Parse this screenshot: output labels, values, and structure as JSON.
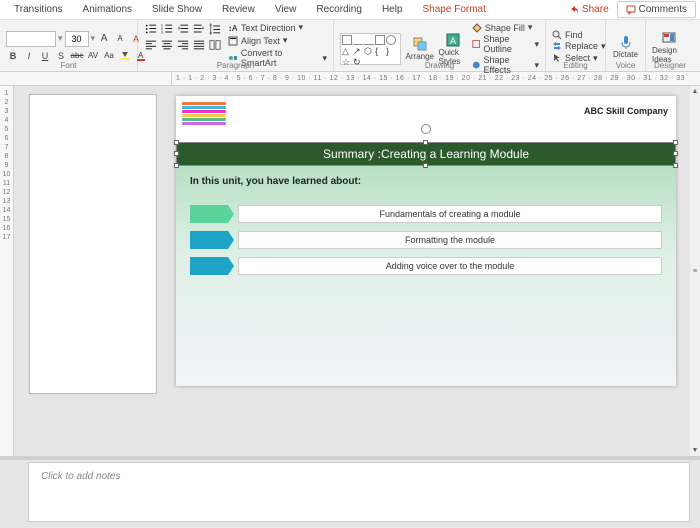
{
  "tabs": {
    "items": [
      "Transitions",
      "Animations",
      "Slide Show",
      "Review",
      "View",
      "Recording",
      "Help",
      "Shape Format"
    ],
    "active_index": 7
  },
  "topright": {
    "share": "Share",
    "comments": "Comments"
  },
  "ribbon": {
    "font": {
      "label": "Font",
      "size": "30",
      "inc_a": "A",
      "dec_a": "A",
      "clear": "A",
      "b": "B",
      "i": "I",
      "u": "U",
      "s": "S",
      "abc": "abc",
      "av": "AV",
      "aa": "Aa"
    },
    "paragraph": {
      "label": "Paragraph",
      "text_direction": "Text Direction",
      "align_text": "Align Text",
      "convert": "Convert to SmartArt"
    },
    "drawing": {
      "label": "Drawing",
      "arrange": "Arrange",
      "quick_styles": "Quick Styles",
      "shape_fill": "Shape Fill",
      "shape_outline": "Shape Outline",
      "shape_effects": "Shape Effects"
    },
    "editing": {
      "label": "Editing",
      "find": "Find",
      "replace": "Replace",
      "select": "Select"
    },
    "voice": {
      "label": "Voice",
      "dictate": "Dictate"
    },
    "designer": {
      "label": "Designer",
      "ideas": "Design Ideas"
    }
  },
  "ruler": {
    "h": "1 · 1 · 2 · 3 · 4 · 5 · 6 · 7 · 8 · 9 · 10 · 11 · 12 · 13 · 14 · 15 · 16 · 17 · 18 · 19 · 20 · 21 · 22 · 23 · 24 · 25 · 26 · 27 · 28 · 29 · 30 · 31 · 32 · 33",
    "v": [
      "1",
      "2",
      "3",
      "4",
      "5",
      "6",
      "7",
      "8",
      "9",
      "10",
      "11",
      "12",
      "13",
      "14",
      "15",
      "16",
      "17"
    ]
  },
  "slide": {
    "company": "ABC Skill Company",
    "title": "Summary :Creating a Learning Module",
    "intro": "In this unit, you have learned about:",
    "items": [
      "Fundamentals of creating a module",
      "Formatting the module",
      "Adding voice over to the module"
    ]
  },
  "notes": {
    "placeholder": "Click to add notes"
  }
}
